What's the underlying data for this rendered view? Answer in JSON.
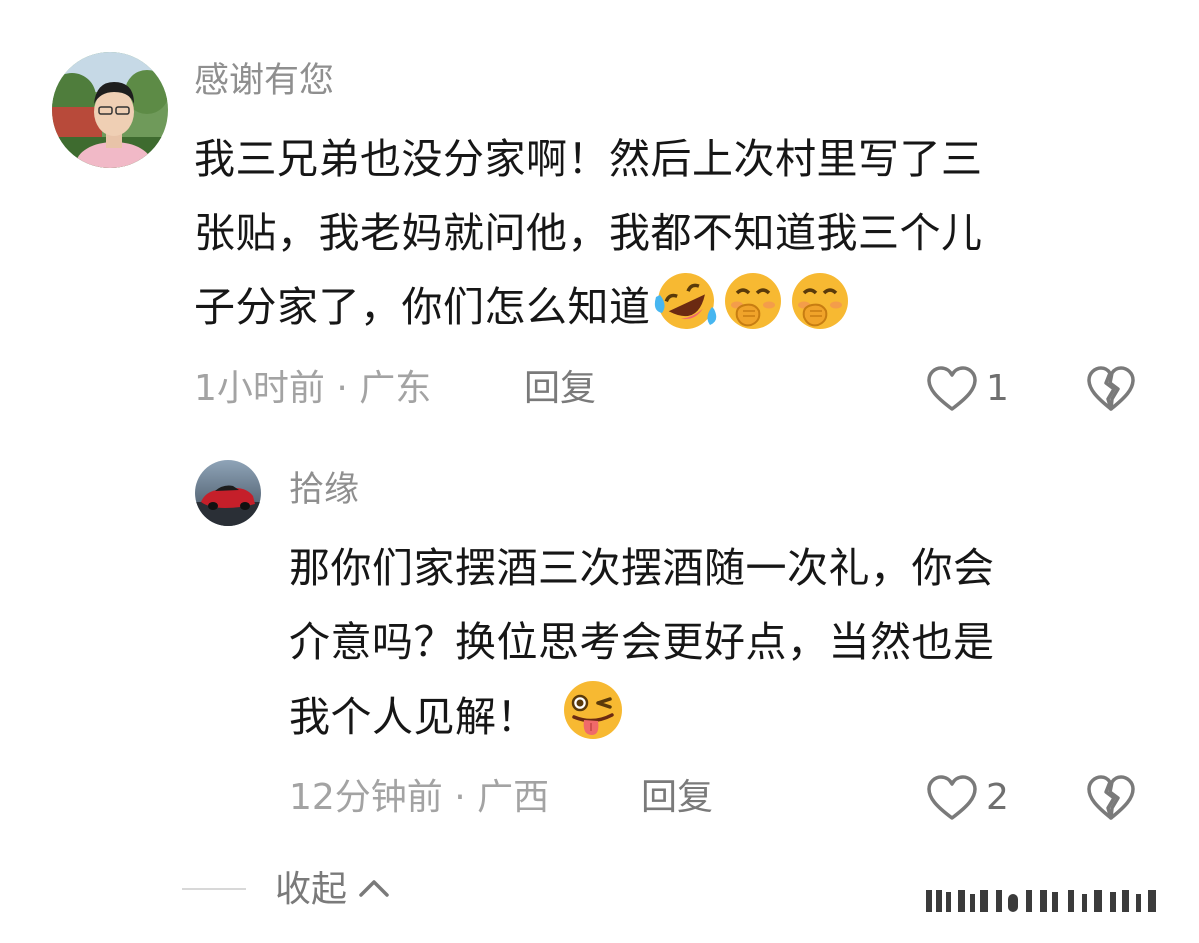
{
  "comment": {
    "username": "感谢有您",
    "text_lines": [
      "我三兄弟也没分家啊！然后上次村里写了三",
      "张贴，我老妈就问他，我都不知道我三个儿",
      "子分家了，你们怎么知道"
    ],
    "emojis": [
      "rofl-emoji",
      "shy-laugh-emoji",
      "shy-laugh-emoji"
    ],
    "meta": "1小时前 · 广东",
    "reply_label": "回复",
    "like_count": "1"
  },
  "reply": {
    "username": "拾缘",
    "text_lines": [
      "那你们家摆酒三次摆酒随一次礼，你会",
      "介意吗？换位思考会更好点，当然也是",
      "我个人见解！"
    ],
    "emojis": [
      "wink-tongue-emoji"
    ],
    "meta": "12分钟前 · 广西",
    "reply_label": "回复",
    "like_count": "2"
  },
  "collapse_label": "收起",
  "colors": {
    "emoji_yellow": "#f7b932",
    "tongue": "#f06a6a",
    "tears": "#47b6f0"
  }
}
